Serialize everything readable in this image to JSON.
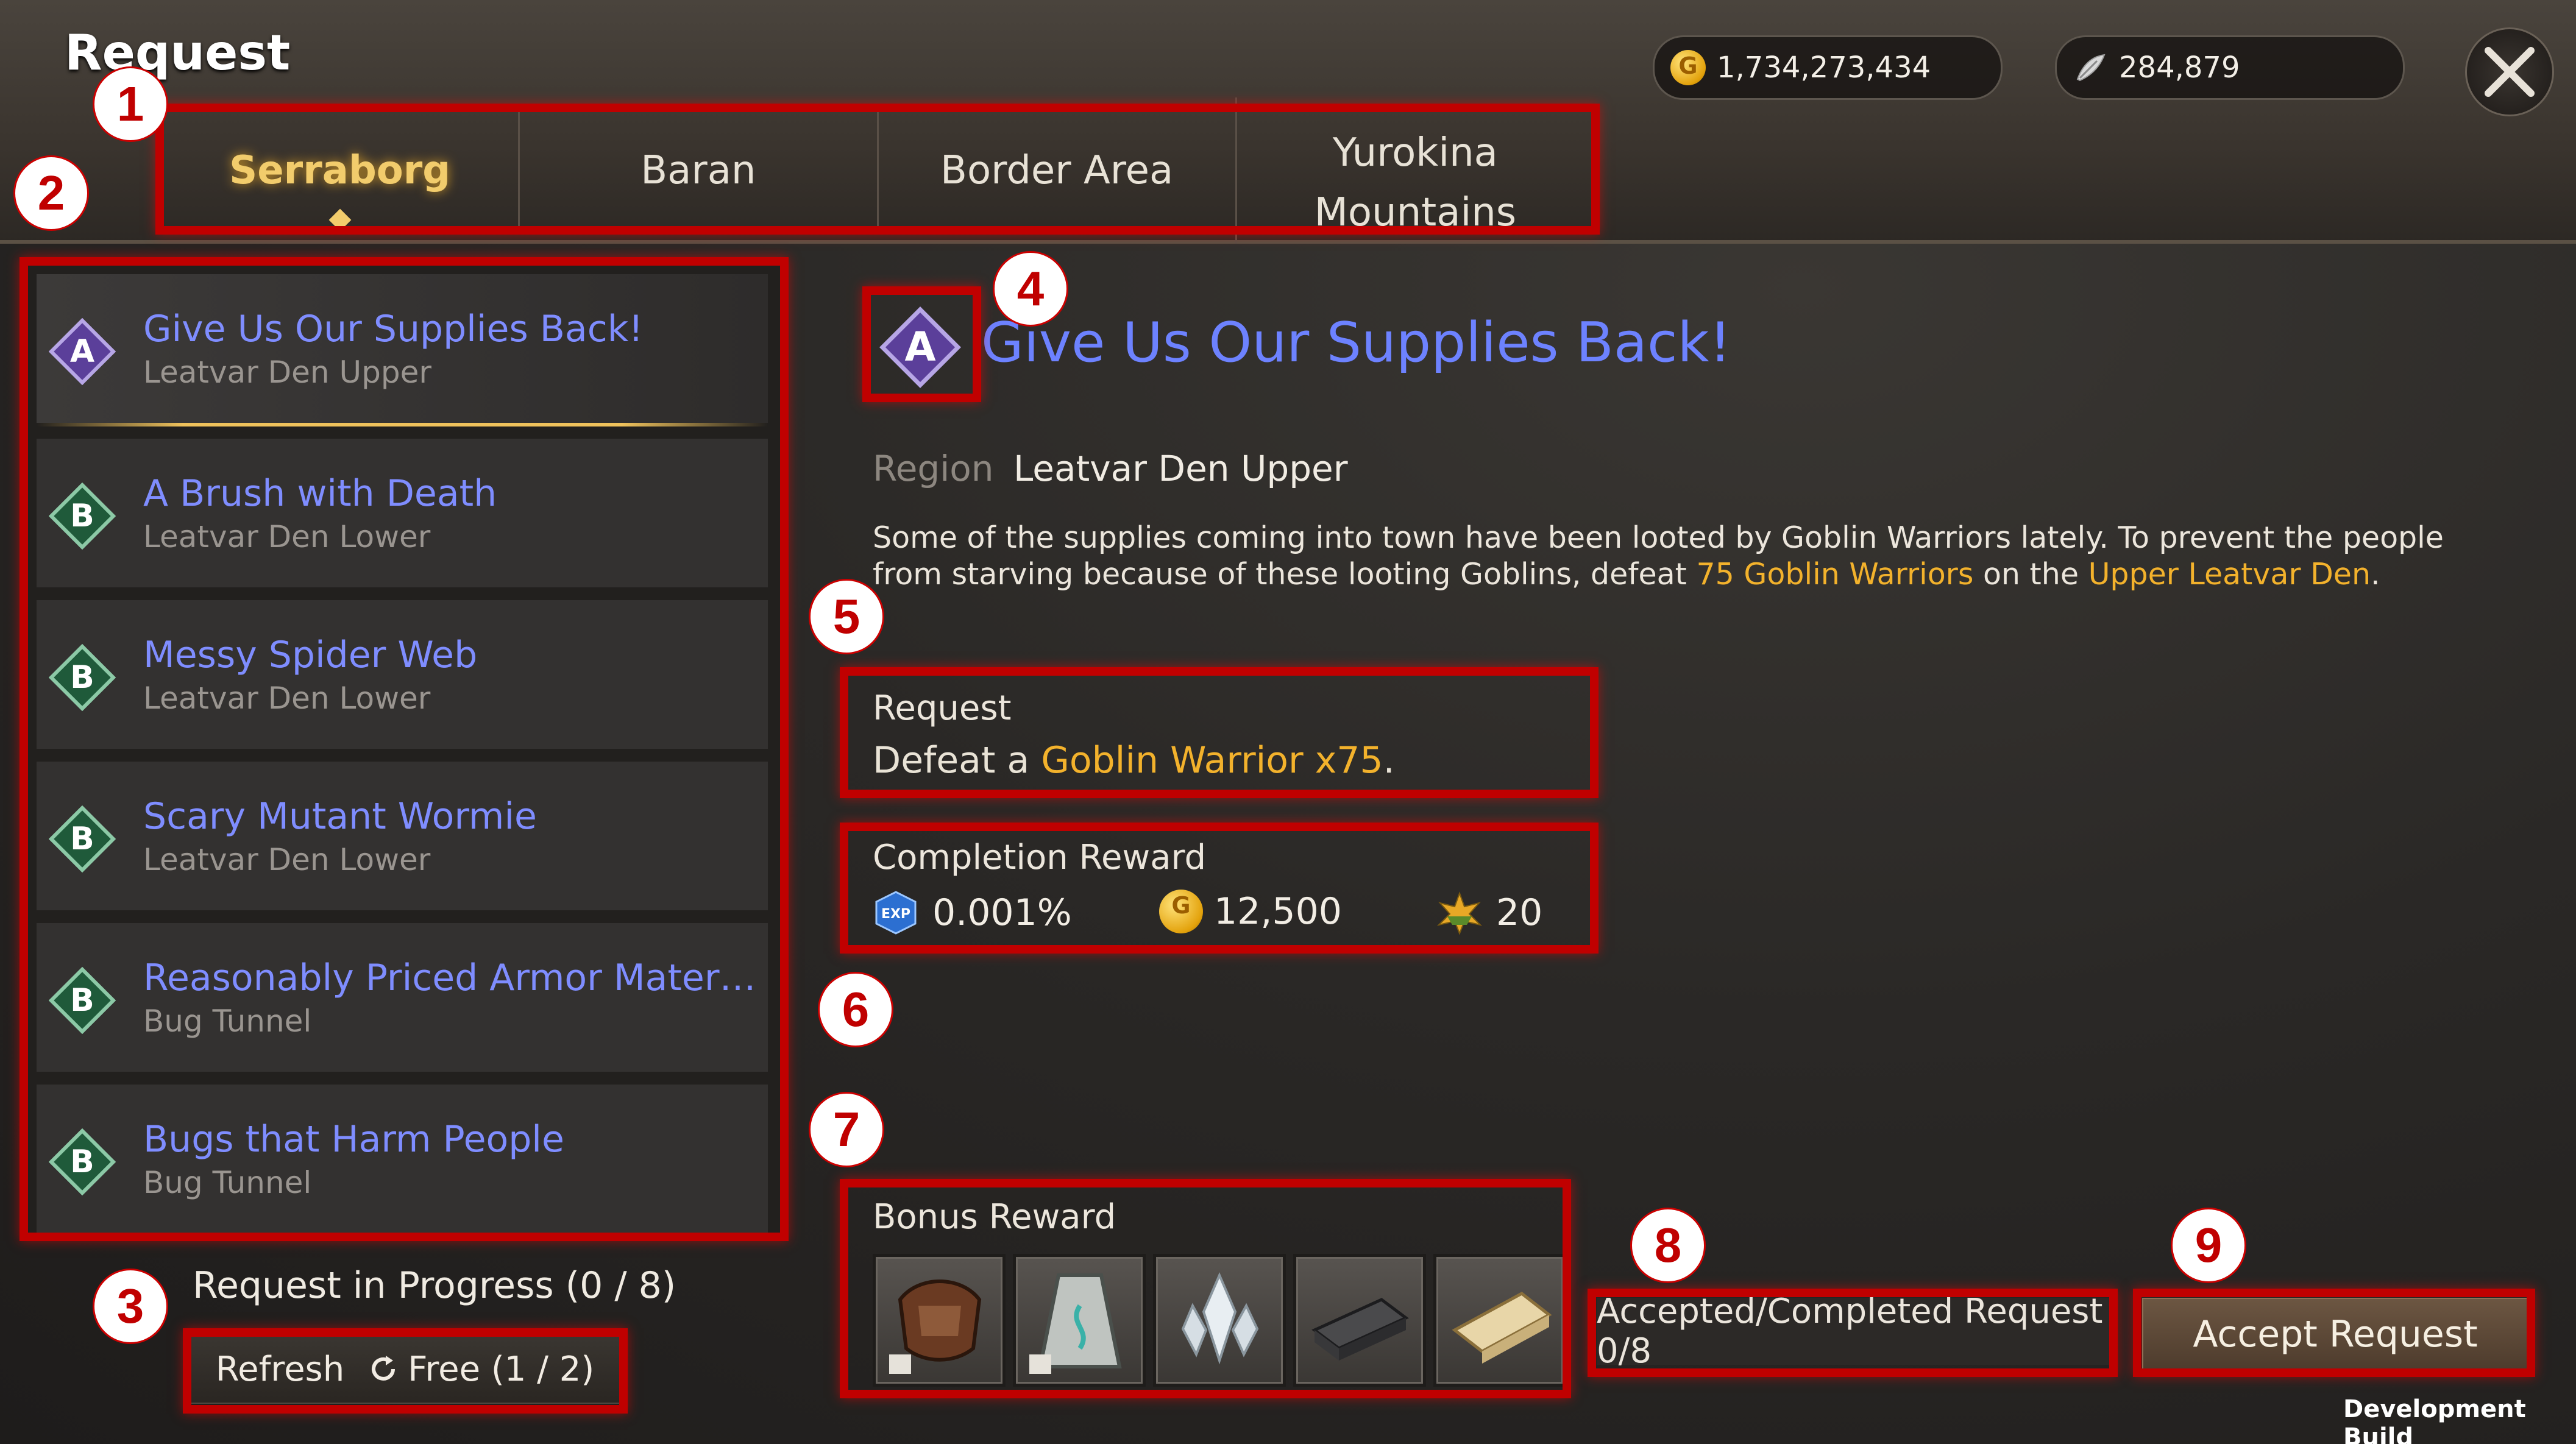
{
  "window": {
    "title": "Request"
  },
  "currency": {
    "gold": "1,734,273,434",
    "gems": "284,879"
  },
  "tabs": [
    "Serraborg",
    "Baran",
    "Border Area",
    "Yurokina Mountains"
  ],
  "requests": [
    {
      "grade": "A",
      "title": "Give Us Our Supplies Back!",
      "location": "Leatvar Den Upper"
    },
    {
      "grade": "B",
      "title": "A Brush with Death",
      "location": "Leatvar Den Lower"
    },
    {
      "grade": "B",
      "title": "Messy Spider Web",
      "location": "Leatvar Den Lower"
    },
    {
      "grade": "B",
      "title": "Scary Mutant Wormie",
      "location": "Leatvar Den Lower"
    },
    {
      "grade": "B",
      "title": "Reasonably Priced Armor Mater…",
      "location": "Bug Tunnel"
    },
    {
      "grade": "B",
      "title": "Bugs that Harm People",
      "location": "Bug Tunnel"
    }
  ],
  "progress": "Request in Progress (0 / 8)",
  "refresh": {
    "label": "Refresh",
    "free": "Free (1 / 2)"
  },
  "detail": {
    "grade": "A",
    "title": "Give Us Our Supplies Back!",
    "region_label": "Region",
    "region": "Leatvar Den Upper",
    "desc_1": "Some of the supplies coming into town have been looted by Goblin Warriors lately. To prevent the people from starving because of these looting Goblins, defeat ",
    "desc_hl1": "75 Goblin Warriors",
    "desc_2": " on the ",
    "desc_hl2": "Upper Leatvar Den",
    "desc_3": ".",
    "request_label": "Request",
    "request_pre": "Defeat a ",
    "request_target": "Goblin Warrior x75",
    "request_post": ".",
    "completion_label": "Completion Reward",
    "rewards": {
      "exp": "0.001%",
      "gold": "12,500",
      "points": "20"
    },
    "bonus_label": "Bonus Reward"
  },
  "accepted": "Accepted/Completed Request 0/8",
  "accept_button": "Accept Request",
  "dev_build": "Development Build",
  "annotations": [
    "1",
    "2",
    "3",
    "4",
    "5",
    "6",
    "7",
    "8",
    "9"
  ],
  "colors": {
    "annotation": "#c00000",
    "title_blue": "#6d82ff",
    "highlight": "#f3b22c",
    "grade_a": "#5b3f9a",
    "grade_b": "#1f5a3a"
  }
}
